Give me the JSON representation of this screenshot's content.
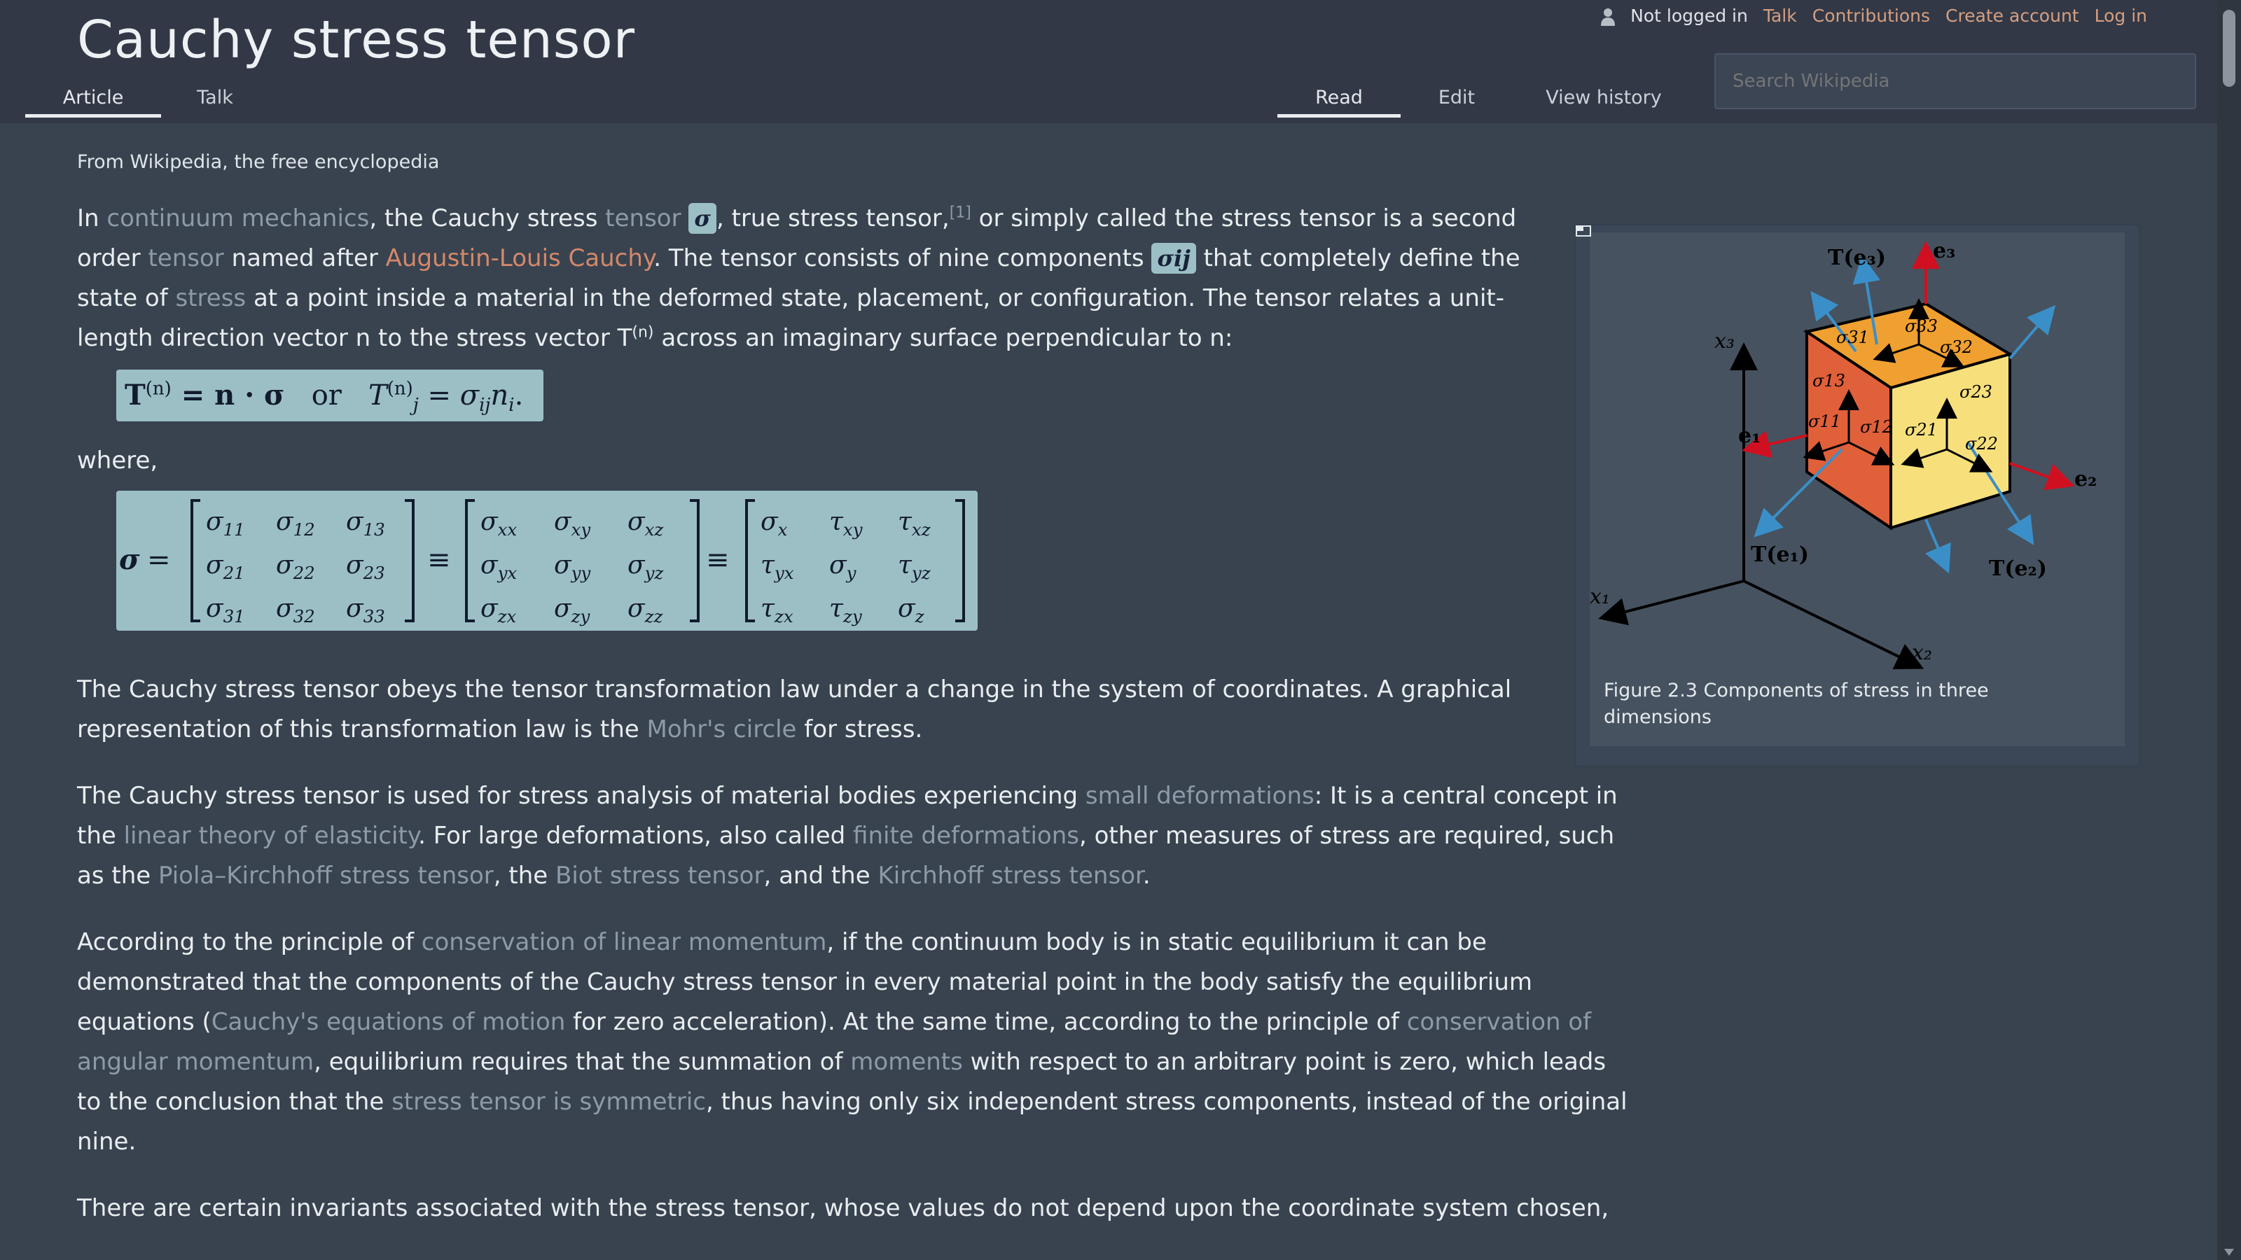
{
  "page": {
    "title": "Cauchy stress tensor",
    "tagline": "From Wikipedia, the free encyclopedia"
  },
  "personal_tools": {
    "status": "Not logged in",
    "talk": "Talk",
    "contributions": "Contributions",
    "create_account": "Create account",
    "log_in": "Log in"
  },
  "tabs": {
    "article": "Article",
    "talk": "Talk",
    "read": "Read",
    "edit": "Edit",
    "view_history": "View history"
  },
  "search": {
    "placeholder": "Search Wikipedia"
  },
  "intro": {
    "t1": "In ",
    "l_continuum": "continuum mechanics",
    "t2": ", the Cauchy stress ",
    "l_tensor": "tensor",
    "sym_sigma": "σ",
    "t3": ", true stress tensor,",
    "ref1": "[1]",
    "t4": " or simply called the stress tensor is a second order ",
    "l_tensor2": "tensor",
    "t5": " named after ",
    "l_cauchy": "Augustin-Louis Cauchy",
    "t6": ". The tensor consists of nine components ",
    "sym_sigma_ij": "σij",
    "t7": " that completely define the state of ",
    "l_stress": "stress",
    "t8": " at a point inside a material in the deformed state, placement, or configuration. The tensor relates a unit-length direction vector n to the stress vector T",
    "sup_n": "(n)",
    "t9": " across an imaginary surface perpendicular to n:"
  },
  "equation1": {
    "T": "T",
    "T_sup": "(n)",
    "rhs": " = n · σ",
    "or": "or",
    "Tj": "T",
    "Tj_sup": "(n)",
    "Tj_sub": "j",
    "rhs2": " = σ",
    "rhs2_sub": "ij",
    "rhs2_n": "n",
    "rhs2_n_sub": "i",
    "dot": "."
  },
  "where": "where,",
  "equation2": {
    "lhs": "σ",
    "eq": "=",
    "equiv": "≡",
    "m1": [
      [
        "σ11",
        "σ12",
        "σ13"
      ],
      [
        "σ21",
        "σ22",
        "σ23"
      ],
      [
        "σ31",
        "σ32",
        "σ33"
      ]
    ],
    "m2": [
      [
        "σxx",
        "σxy",
        "σxz"
      ],
      [
        "σyx",
        "σyy",
        "σyz"
      ],
      [
        "σzx",
        "σzy",
        "σzz"
      ]
    ],
    "m3": [
      [
        "σx",
        "τxy",
        "τxz"
      ],
      [
        "τyx",
        "σy",
        "τyz"
      ],
      [
        "τzx",
        "τzy",
        "σz"
      ]
    ]
  },
  "p2": {
    "t1": "The Cauchy stress tensor obeys the tensor transformation law under a change in the system of coordinates. A graphical representation of this transformation law is the ",
    "l_mohr": "Mohr's circle",
    "t2": " for stress."
  },
  "p3": {
    "t1": "The Cauchy stress tensor is used for stress analysis of material bodies experiencing ",
    "l_small": "small deformations",
    "t2": ": It is a central concept in the ",
    "l_linear": "linear theory of elasticity",
    "t3": ". For large deformations, also called ",
    "l_finite": "finite deformations",
    "t4": ", other measures of stress are required, such as the ",
    "l_piola": "Piola–Kirchhoff stress tensor",
    "t5": ", the ",
    "l_biot": "Biot stress tensor",
    "t6": ", and the ",
    "l_kirchhoff": "Kirchhoff stress tensor",
    "t7": "."
  },
  "p4": {
    "t1": "According to the principle of ",
    "l_linmom": "conservation of linear momentum",
    "t2": ", if the continuum body is in static equilibrium it can be demonstrated that the components of the Cauchy stress tensor in every material point in the body satisfy the equilibrium equations (",
    "l_motion": "Cauchy's equations of motion",
    "t3": " for zero acceleration). At the same time, according to the principle of ",
    "l_angmom": "conservation of angular momentum",
    "t4": ", equilibrium requires that the summation of ",
    "l_moments": "moments",
    "t5": " with respect to an arbitrary point is zero, which leads to the conclusion that the ",
    "l_symmetric": "stress tensor is symmetric",
    "t6": ", thus having only six independent stress components, instead of the original nine."
  },
  "p5": {
    "t1": "There are certain invariants associated with the stress tensor, whose values do not depend upon the coordinate system chosen,"
  },
  "figure": {
    "caption": "Figure 2.3 Components of stress in three dimensions",
    "labels": {
      "x1": "x₁",
      "x2": "x₂",
      "x3": "x₃",
      "e1": "e₁",
      "e2": "e₂",
      "e3": "e₃",
      "Te1": "T(e₁)",
      "Te2": "T(e₂)",
      "Te3": "T(e₃)",
      "s11": "σ11",
      "s12": "σ12",
      "s13": "σ13",
      "s21": "σ21",
      "s22": "σ22",
      "s23": "σ23",
      "s31": "σ31",
      "s32": "σ32",
      "s33": "σ33"
    },
    "colors": {
      "face_left": "#e0603a",
      "face_right": "#f7e07c",
      "face_top": "#f0a030",
      "arrow_blue": "#3b8fc8",
      "arrow_red": "#d01020"
    }
  }
}
